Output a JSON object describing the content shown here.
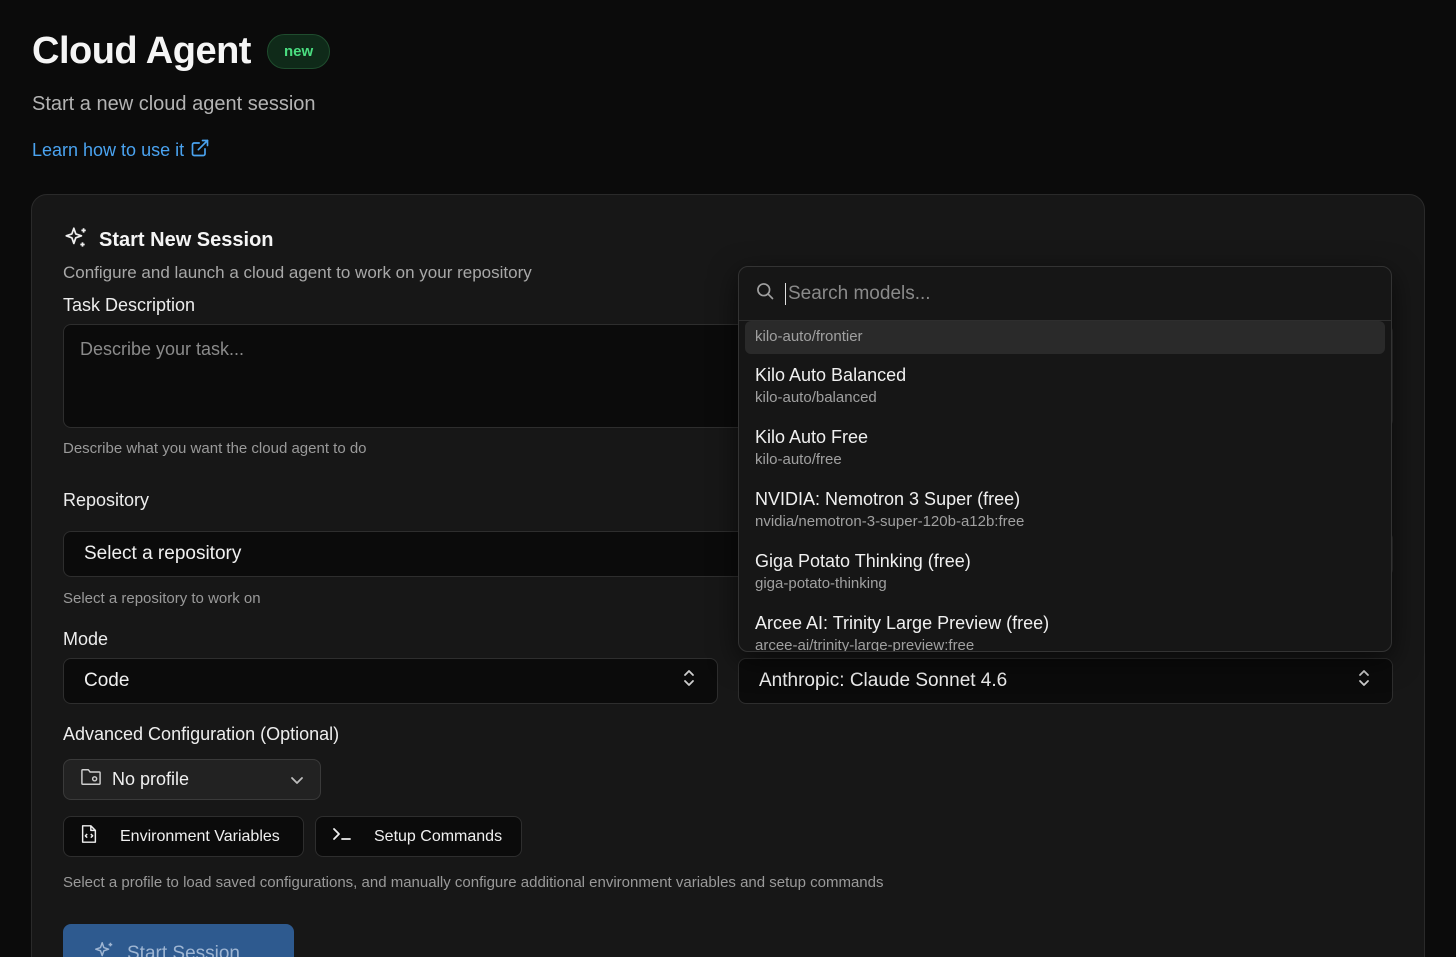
{
  "header": {
    "title": "Cloud Agent",
    "badge": "new",
    "subtitle": "Start a new cloud agent session",
    "learn_link": "Learn how to use it"
  },
  "card": {
    "title": "Start New Session",
    "description": "Configure and launch a cloud agent to work on your repository"
  },
  "task": {
    "label": "Task Description",
    "placeholder": "Describe your task...",
    "help": "Describe what you want the cloud agent to do"
  },
  "repository": {
    "label": "Repository",
    "value": "Select a repository",
    "help": "Select a repository to work on"
  },
  "mode": {
    "label": "Mode",
    "value": "Code"
  },
  "model": {
    "value": "Anthropic: Claude Sonnet 4.6"
  },
  "advanced": {
    "label": "Advanced Configuration (Optional)",
    "profile": "No profile",
    "env_button": "Environment Variables",
    "setup_button": "Setup Commands",
    "help": "Select a profile to load saved configurations, and manually configure additional environment variables and setup commands"
  },
  "start_button": "Start Session",
  "model_dropdown": {
    "search_placeholder": "Search models...",
    "highlighted_id": "kilo-auto/frontier",
    "options": [
      {
        "name": "Kilo Auto Balanced",
        "id": "kilo-auto/balanced"
      },
      {
        "name": "Kilo Auto Free",
        "id": "kilo-auto/free"
      },
      {
        "name": "NVIDIA: Nemotron 3 Super (free)",
        "id": "nvidia/nemotron-3-super-120b-a12b:free"
      },
      {
        "name": "Giga Potato Thinking (free)",
        "id": "giga-potato-thinking"
      },
      {
        "name": "Arcee AI: Trinity Large Preview (free)",
        "id": "arcee-ai/trinity-large-preview:free"
      }
    ]
  },
  "colors": {
    "accent_link": "#4aa3f0",
    "badge_green": "#4ade80",
    "start_button": "#2e5a8f"
  }
}
